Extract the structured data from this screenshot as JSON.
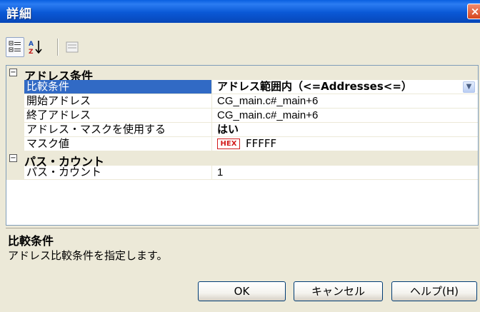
{
  "window": {
    "title": "詳細",
    "close_glyph": "×"
  },
  "toolbar": {
    "categorized_icon": "categorized-view-icon",
    "alphabetical_icon": "sort-az-icon",
    "property_pages_icon": "property-pages-icon"
  },
  "grid": {
    "categories": [
      {
        "label": "アドレス条件",
        "toggle": "⊟",
        "properties": [
          {
            "name": "比較条件",
            "value": "アドレス範囲内（<=Addresses<=）",
            "selected": true,
            "bold": true,
            "has_dropdown": true
          },
          {
            "name": "開始アドレス",
            "value": "CG_main.c#_main+6"
          },
          {
            "name": "終了アドレス",
            "value": "CG_main.c#_main+6"
          },
          {
            "name": "アドレス・マスクを使用する",
            "value": "はい",
            "bold": true
          },
          {
            "name": "マスク値",
            "value": "FFFFF",
            "badge": "HEX"
          }
        ]
      },
      {
        "label": "パス・カウント",
        "toggle": "⊟",
        "properties": [
          {
            "name": "パス・カウント",
            "value": "1"
          }
        ]
      }
    ]
  },
  "description": {
    "title": "比較条件",
    "text": "アドレス比較条件を指定します。"
  },
  "buttons": {
    "ok": "OK",
    "cancel": "キャンセル",
    "help": "ヘルプ(H)"
  },
  "colors": {
    "selection": "#316ac5",
    "titlebar": "#0a58d6",
    "dialog_bg": "#ece9d8",
    "hex_badge": "#d31b1b"
  }
}
